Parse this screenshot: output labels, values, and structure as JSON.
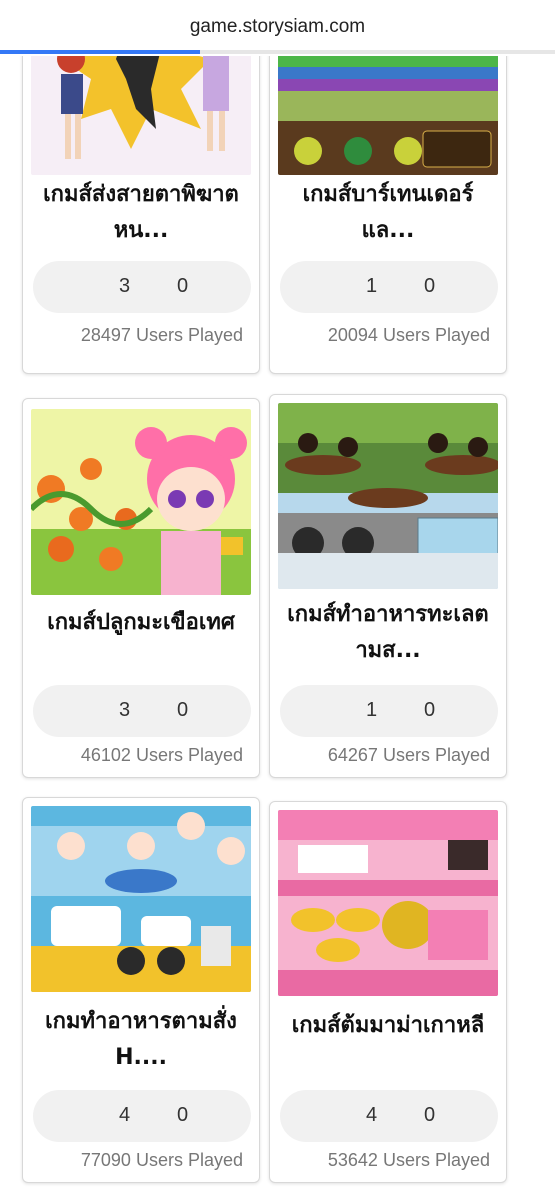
{
  "browser": {
    "url": "game.storysiam.com",
    "load_progress": 0.36
  },
  "cards": [
    {
      "title_line1": "เกมส์ส่งสายตาพิฆาต",
      "title_line2": "หน...",
      "up": "3",
      "down": "0",
      "plays": "28497 Users Played",
      "thumb": "anime-girls-flash"
    },
    {
      "title_line1": "เกมส์บาร์เทนเดอร์",
      "title_line2": "แล...",
      "up": "1",
      "down": "0",
      "plays": "20094 Users Played",
      "thumb": "rainbow-bar"
    },
    {
      "title_line1": "เกมส์ปลูกมะเขือเทศ",
      "title_line2": "",
      "up": "3",
      "down": "0",
      "plays": "46102 Users Played",
      "thumb": "tomato-girl"
    },
    {
      "title_line1": "เกมส์ทำอาหารทะเลต",
      "title_line2": "ามส...",
      "up": "1",
      "down": "0",
      "plays": "64267 Users Played",
      "thumb": "seafood-restaurant"
    },
    {
      "title_line1": "เกมทำอาหารตามสั่ง",
      "title_line2": "H....",
      "up": "4",
      "down": "0",
      "plays": "77090 Users Played",
      "thumb": "cooking-restaurant"
    },
    {
      "title_line1": "เกมส์ต้มมาม่าเกาหลี",
      "title_line2": "",
      "up": "4",
      "down": "0",
      "plays": "53642 Users Played",
      "thumb": "korean-kitchen"
    }
  ]
}
